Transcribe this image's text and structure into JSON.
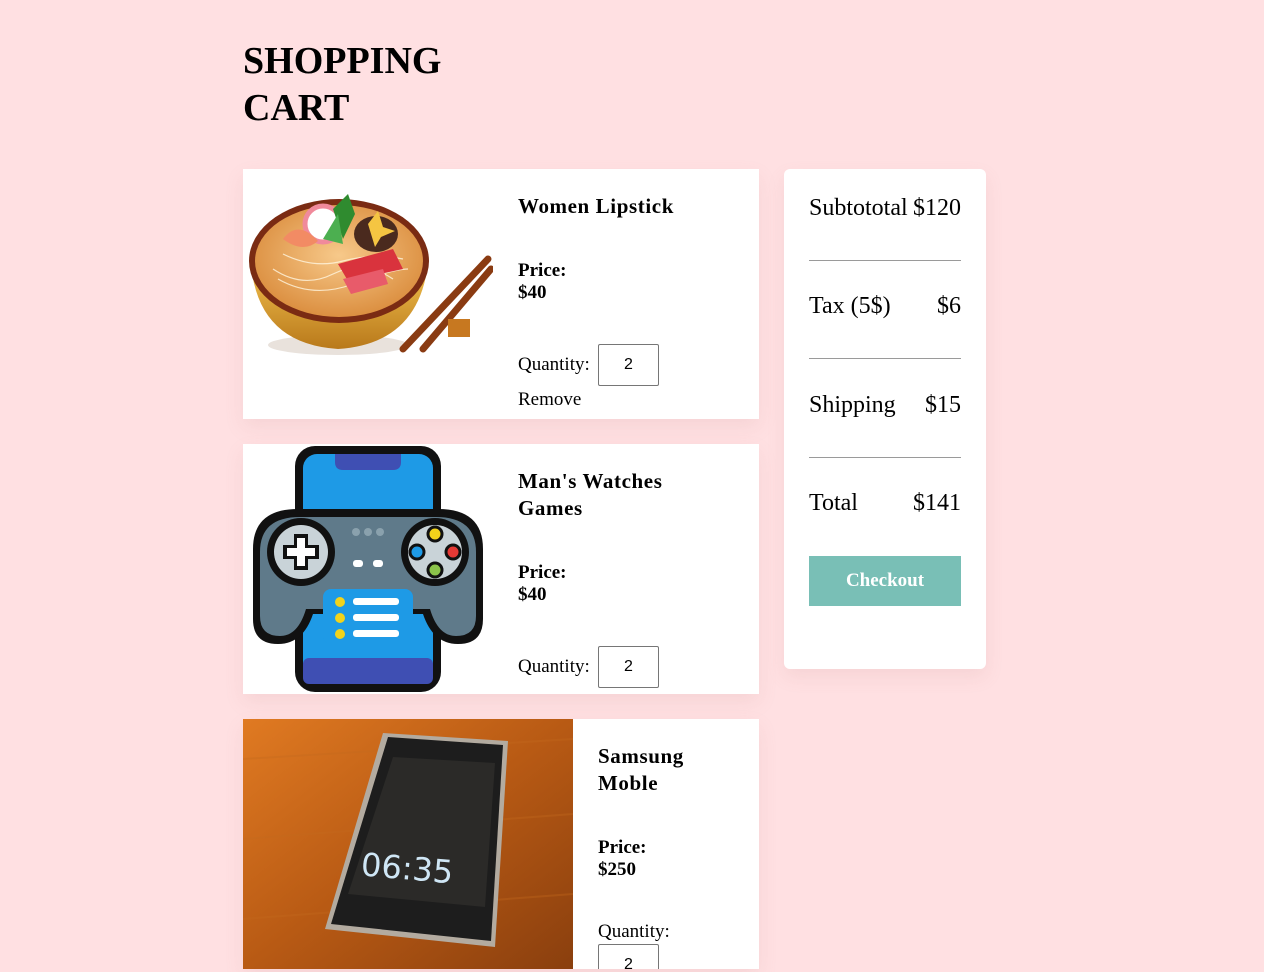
{
  "page": {
    "title": "SHOPPING\n CART"
  },
  "cart": {
    "items": [
      {
        "name": "Women Lipstick",
        "price": "Price: $40",
        "quantity_label": "Quantity:",
        "quantity": "2",
        "remove_label": "Remove",
        "image": "noodle-bowl-illustration"
      },
      {
        "name": "Man's Watches Games",
        "price": "Price: $40",
        "quantity_label": "Quantity:",
        "quantity": "2",
        "image": "game-controller-phone-illustration"
      },
      {
        "name": "Samsung Moble",
        "price": "Price: $250",
        "quantity_label": "Quantity:",
        "quantity": "2",
        "phone_clock": "06:35",
        "image": "smartphone-photo"
      }
    ]
  },
  "summary": {
    "subtotal_label": "Subtototal",
    "subtotal_value": "$120",
    "tax_label": "Tax (5$)",
    "tax_value": "$6",
    "shipping_label": "Shipping",
    "shipping_value": "$15",
    "total_label": "Total",
    "total_value": "$141",
    "checkout_label": "Checkout"
  },
  "colors": {
    "background": "#ffe0e2",
    "checkout": "#79bfb6"
  }
}
